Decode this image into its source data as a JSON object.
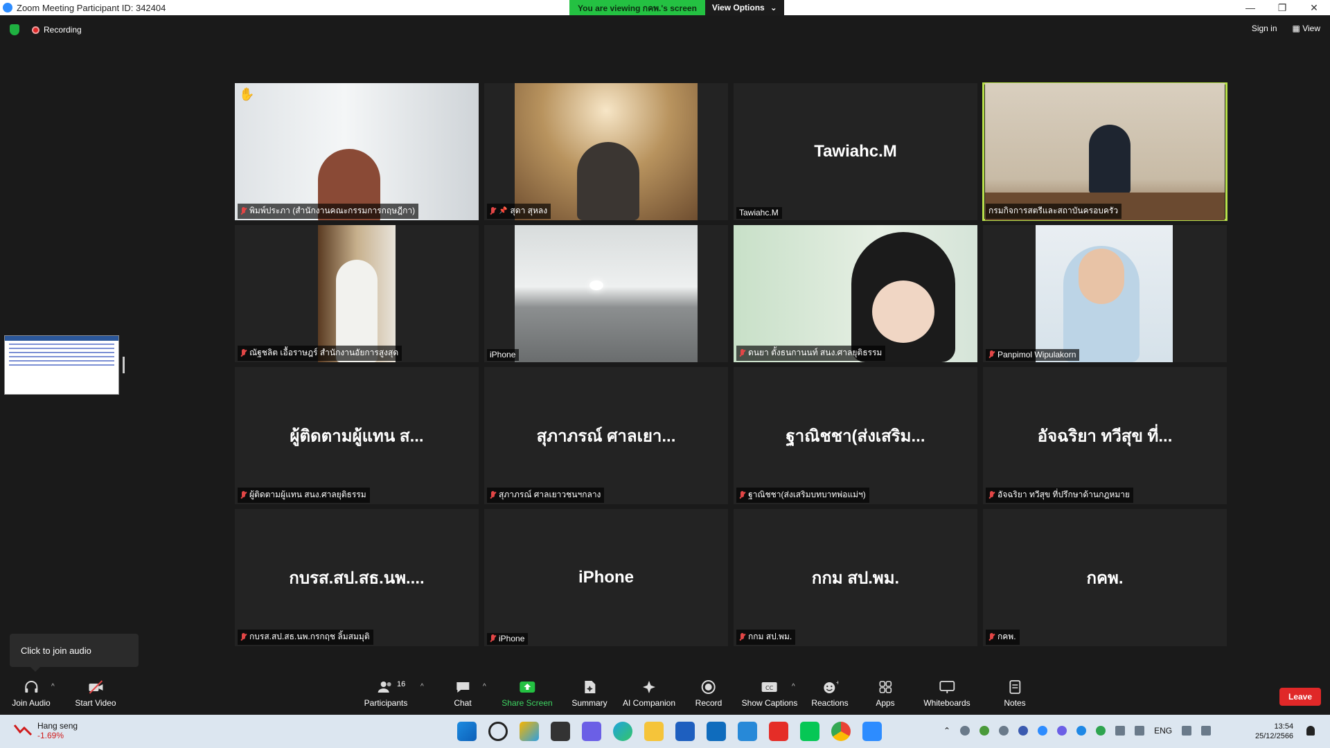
{
  "window": {
    "title": "Zoom Meeting Participant ID: 342404",
    "controls": [
      "—",
      "❐",
      "✕"
    ]
  },
  "viewing_bar": {
    "status": "You are viewing กคพ.'s screen",
    "options_label": "View Options"
  },
  "top": {
    "recording": "Recording",
    "sign_in": "Sign in",
    "view": "View"
  },
  "tiles": [
    {
      "big": "",
      "name": "พิมพ์ประภา (สำนักงานคณะกรรมการกฤษฎีกา)",
      "video": true,
      "muted": true,
      "hand": true
    },
    {
      "big": "",
      "name": "สุดา สุหลง",
      "video": true,
      "muted": true,
      "pinned": true
    },
    {
      "big": "Tawiahc.M",
      "name": "Tawiahc.M",
      "video": false,
      "muted": false
    },
    {
      "big": "",
      "name": "กรมกิจการสตรีและสถาบันครอบครัว",
      "video": true,
      "muted": false,
      "active": true
    },
    {
      "big": "",
      "name": "ณัฐชลิต เอื้อราษฎร์ สำนักงานอัยการสูงสุด",
      "video": true,
      "muted": true
    },
    {
      "big": "",
      "name": "iPhone",
      "video": true,
      "muted": false
    },
    {
      "big": "",
      "name": "ดนยา ตั้งธนกานนท์ สนง.ศาลยุติธรรม",
      "video": true,
      "muted": true
    },
    {
      "big": "",
      "name": "Panpimol Wipulakorn",
      "video": true,
      "muted": true
    },
    {
      "big": "ผู้ติดตามผู้แทน ส...",
      "name": "ผู้ติดตามผู้แทน สนง.ศาลยุติธรรม",
      "video": false,
      "muted": true
    },
    {
      "big": "สุภาภรณ์  ศาลเยา...",
      "name": "สุภาภรณ์  ศาลเยาวชนฯกลาง",
      "video": false,
      "muted": true
    },
    {
      "big": "ฐาณิชชา(ส่งเสริม...",
      "name": "ฐาณิชชา(ส่งเสริมบทบาทพ่อแม่ฯ)",
      "video": false,
      "muted": true
    },
    {
      "big": "อัจฉริยา ทวีสุข ที่...",
      "name": "อัจฉริยา ทวีสุข ที่ปรึกษาด้านกฎหมาย",
      "video": false,
      "muted": true
    },
    {
      "big": "กบรส.สป.สธ.นพ....",
      "name": "กบรส.สป.สธ.นพ.กรกฤช ลิ้มสมมุติ",
      "video": false,
      "muted": true
    },
    {
      "big": "iPhone",
      "name": "iPhone",
      "video": false,
      "muted": true
    },
    {
      "big": "กกม สป.พม.",
      "name": "กกม สป.พม.",
      "video": false,
      "muted": true
    },
    {
      "big": "กคพ.",
      "name": "กคพ.",
      "video": false,
      "muted": true
    }
  ],
  "tooltip": "Click to join audio",
  "toolbar": {
    "join_audio": "Join Audio",
    "start_video": "Start Video",
    "participants": "Participants",
    "participant_count": "16",
    "chat": "Chat",
    "share_screen": "Share Screen",
    "summary": "Summary",
    "ai_companion": "AI Companion",
    "record": "Record",
    "show_captions": "Show Captions",
    "reactions": "Reactions",
    "apps": "Apps",
    "whiteboards": "Whiteboards",
    "notes": "Notes",
    "leave": "Leave"
  },
  "taskbar": {
    "stock_name": "Hang seng",
    "stock_change": "-1.69%",
    "lang": "ENG",
    "time": "13:54",
    "date": "25/12/2566"
  },
  "colors": {
    "share_green": "#3ed562",
    "leave_red": "#e02828",
    "active_speaker": "#b8e04a",
    "viewing_green": "#24c142"
  }
}
